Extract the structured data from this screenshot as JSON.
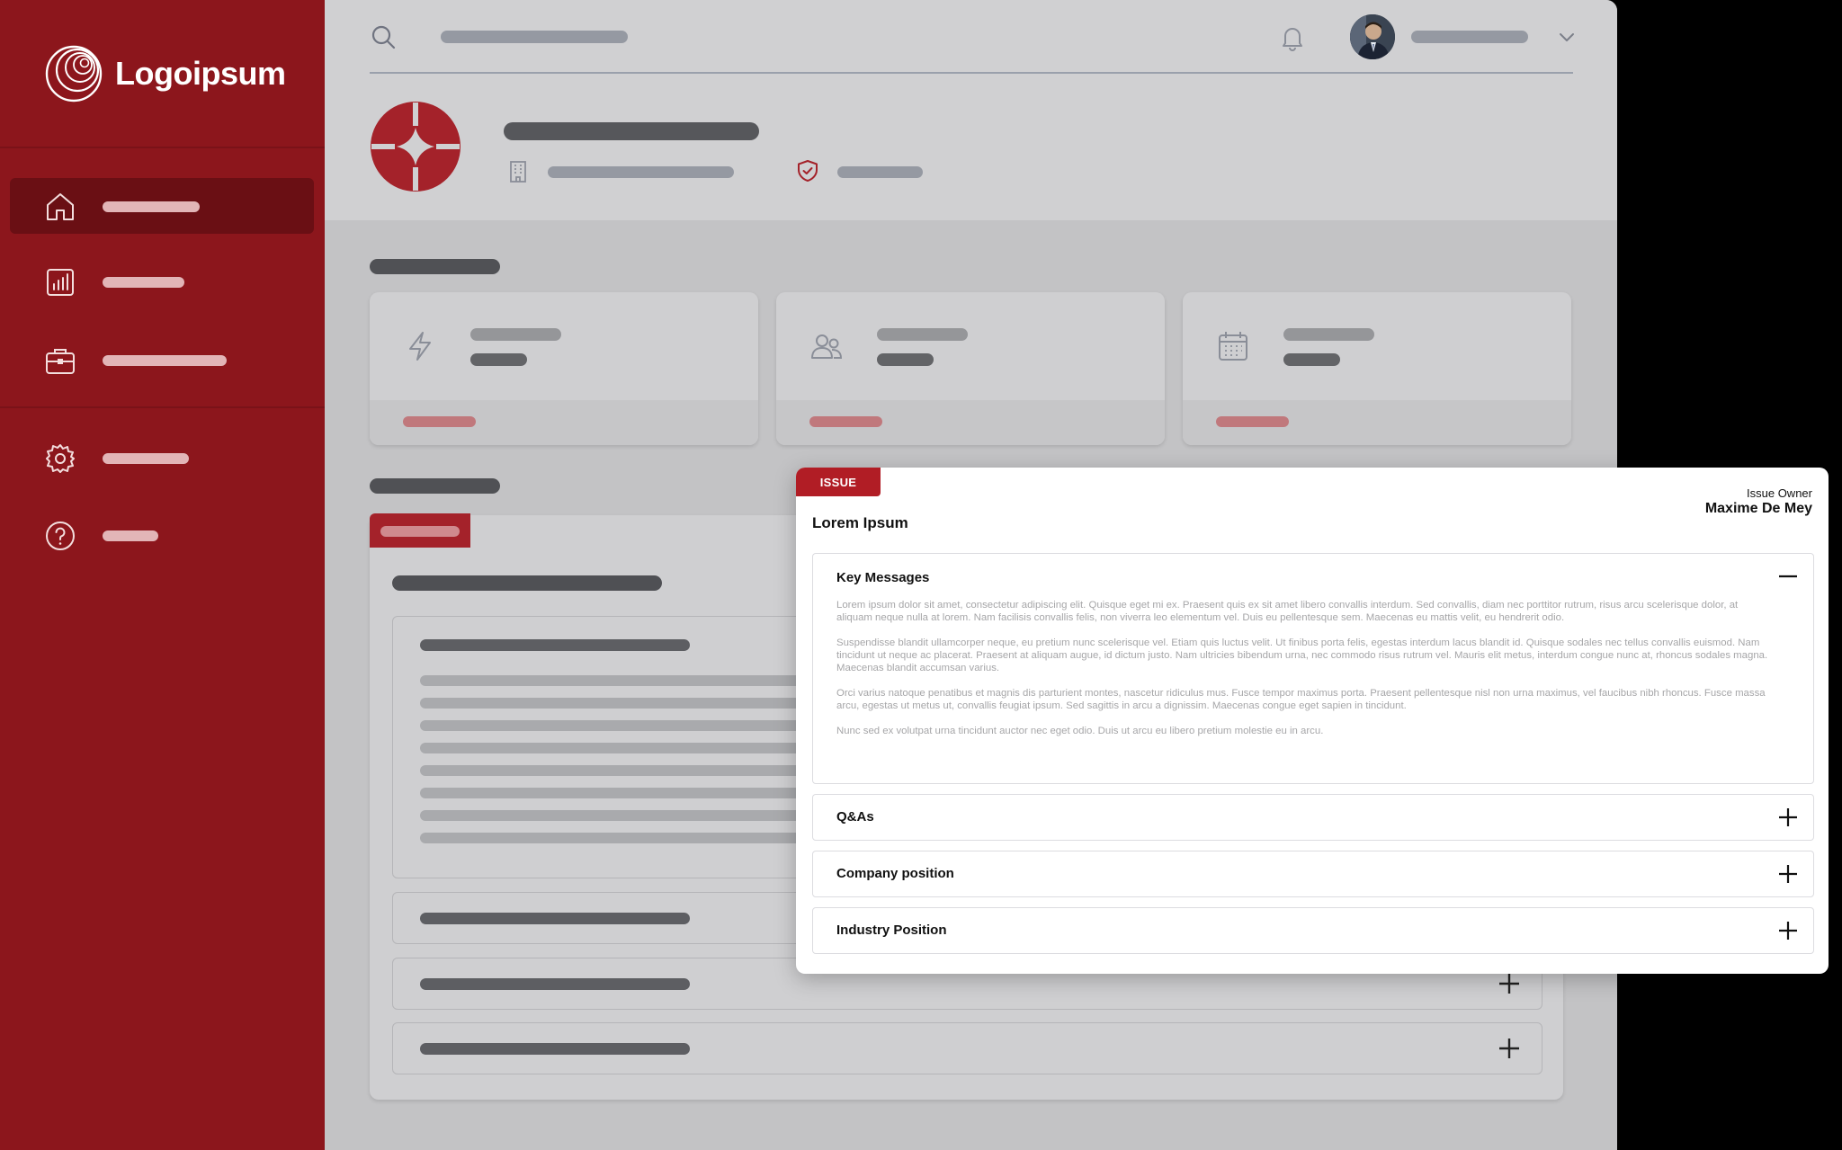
{
  "brand": {
    "name": "Logoipsum",
    "sidebar_color": "#8c161c",
    "accent": "#b11d25"
  },
  "sidebar": {
    "items": [
      {
        "id": "home",
        "icon": "home-icon",
        "active": true
      },
      {
        "id": "analytics",
        "icon": "bar-chart-icon",
        "active": false
      },
      {
        "id": "portfolio",
        "icon": "briefcase-icon",
        "active": false
      },
      {
        "id": "settings",
        "icon": "gear-icon",
        "active": false
      },
      {
        "id": "help",
        "icon": "help-icon",
        "active": false
      }
    ]
  },
  "header": {
    "icons": [
      "search-icon",
      "bell-icon",
      "avatar",
      "chevron-down-icon",
      "building-icon",
      "shield-check-icon"
    ]
  },
  "stat_cards": [
    {
      "icon": "lightning-icon"
    },
    {
      "icon": "users-icon"
    },
    {
      "icon": "calendar-icon"
    }
  ],
  "modal": {
    "badge": "ISSUE",
    "title": "Lorem Ipsum",
    "owner_label": "Issue Owner",
    "owner_name": "Maxime De Mey",
    "sections": [
      {
        "title": "Key Messages",
        "expanded": true,
        "paragraphs": [
          "Lorem ipsum dolor sit amet, consectetur adipiscing elit. Quisque eget mi ex. Praesent quis ex sit amet libero convallis interdum. Sed convallis, diam nec porttitor rutrum, risus arcu scelerisque dolor, at aliquam neque nulla at lorem. Nam facilisis convallis felis, non viverra leo elementum vel. Duis eu pellentesque sem. Maecenas eu mattis velit, eu hendrerit odio.",
          "Suspendisse blandit ullamcorper neque, eu pretium nunc scelerisque vel. Etiam quis luctus velit. Ut finibus porta felis, egestas interdum lacus blandit id. Quisque sodales nec tellus convallis euismod. Nam tincidunt ut neque ac placerat. Praesent at aliquam augue, id dictum justo. Nam ultricies bibendum urna, nec commodo risus rutrum vel. Mauris elit metus, interdum congue nunc at, rhoncus sodales magna. Maecenas blandit accumsan varius.",
          "Orci varius natoque penatibus et magnis dis parturient montes, nascetur ridiculus mus. Fusce tempor maximus porta. Praesent pellentesque nisl non urna maximus, vel faucibus nibh rhoncus. Fusce massa arcu, egestas ut metus ut, convallis feugiat ipsum. Sed sagittis in arcu a dignissim. Maecenas congue eget sapien in tincidunt.",
          "Nunc sed ex volutpat urna tincidunt auctor nec eget odio. Duis ut arcu eu libero pretium molestie eu in arcu."
        ]
      },
      {
        "title": "Q&As",
        "expanded": false
      },
      {
        "title": "Company position",
        "expanded": false
      },
      {
        "title": "Industry Position",
        "expanded": false
      }
    ]
  }
}
